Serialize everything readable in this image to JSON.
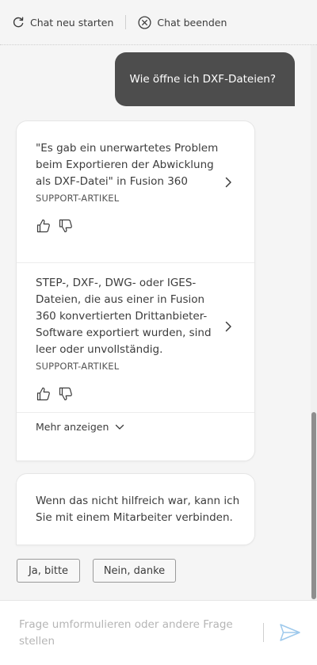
{
  "toolbar": {
    "restart_label": "Chat neu starten",
    "end_label": "Chat beenden"
  },
  "messages": {
    "user_question": "Wie öffne ich DXF-Dateien?",
    "results": [
      {
        "title": "\"Es gab ein unerwartetes Problem beim Exportieren der Abwicklung als DXF-Datei\" in Fusion 360",
        "kind": "SUPPORT-ARTIKEL"
      },
      {
        "title": "STEP-, DXF-, DWG- oder IGES-Dateien, die aus einer in Fusion 360 konvertierten Drittanbieter-Software exportiert wurden, sind leer oder unvollständig.",
        "kind": "SUPPORT-ARTIKEL"
      }
    ],
    "show_more_label": "Mehr anzeigen",
    "bot_followup": "Wenn das nicht hilfreich war, kann ich Sie mit einem Mitarbeiter verbinden."
  },
  "quick_replies": {
    "yes_label": "Ja, bitte",
    "no_label": "Nein, danke"
  },
  "composer": {
    "placeholder": "Frage umformulieren oder andere Frage stellen"
  },
  "colors": {
    "user_bubble": "#4d4d4d",
    "send_icon": "#9ec9ec"
  }
}
